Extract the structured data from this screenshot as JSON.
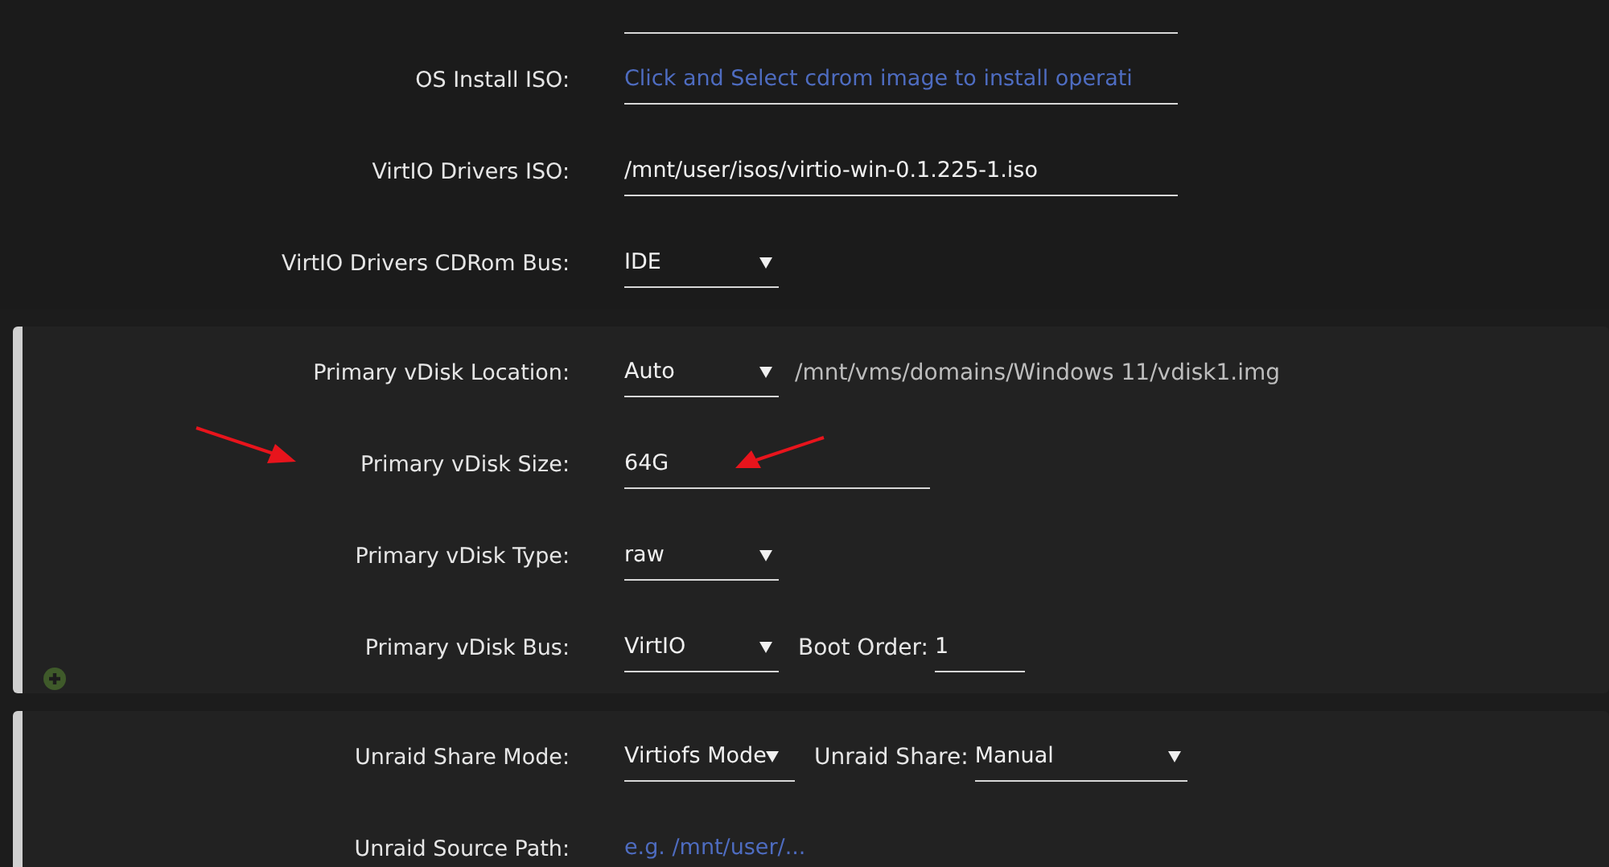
{
  "sections": [
    {
      "rows": [
        {
          "label": null,
          "controls": [
            {
              "kind": "path-field"
            }
          ]
        },
        {
          "label": "OS Install ISO:",
          "controls": [
            {
              "kind": "path-field",
              "placeholder": "Click and Select cdrom image to install operati"
            }
          ]
        },
        {
          "label": "VirtIO Drivers ISO:",
          "controls": [
            {
              "kind": "path-field",
              "value": "/mnt/user/isos/virtio-win-0.1.225-1.iso"
            }
          ]
        },
        {
          "label": "VirtIO Drivers CDRom Bus:",
          "controls": [
            {
              "kind": "select",
              "value": "IDE"
            }
          ]
        }
      ]
    },
    {
      "rows": [
        {
          "label": "Primary vDisk Location:",
          "controls": [
            {
              "kind": "select",
              "value": "Auto"
            },
            {
              "kind": "note",
              "text": "/mnt/vms/domains/Windows 11/vdisk1.img"
            }
          ]
        },
        {
          "label": "Primary vDisk Size:",
          "controls": [
            {
              "kind": "text-field",
              "value": "64G"
            }
          ]
        },
        {
          "label": "Primary vDisk Type:",
          "controls": [
            {
              "kind": "select",
              "value": "raw"
            }
          ]
        },
        {
          "label": "Primary vDisk Bus:",
          "controls": [
            {
              "kind": "select",
              "value": "VirtIO"
            },
            {
              "kind": "inline-label",
              "text": "Boot Order:"
            },
            {
              "kind": "number-field",
              "value": "1"
            }
          ]
        }
      ]
    },
    {
      "rows": [
        {
          "label": "Unraid Share Mode:",
          "controls": [
            {
              "kind": "compact-select",
              "value": "Virtiofs Mode"
            },
            {
              "kind": "inline-label",
              "text": "Unraid Share:"
            },
            {
              "kind": "wide-select",
              "value": "Manual"
            }
          ]
        },
        {
          "label": "Unraid Source Path:",
          "controls": [
            {
              "kind": "path-field",
              "placeholder": "e.g. /mnt/user/..."
            }
          ]
        }
      ]
    }
  ]
}
